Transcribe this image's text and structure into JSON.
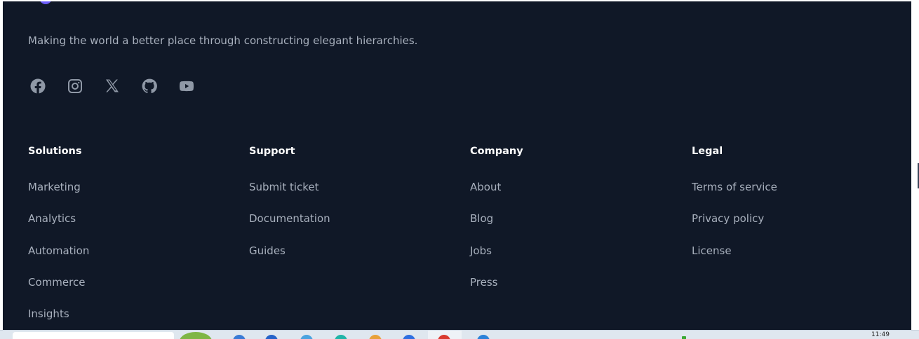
{
  "footer": {
    "tagline": "Making the world a better place through constructing elegant hierarchies.",
    "social": [
      "facebook-icon",
      "instagram-icon",
      "x-icon",
      "github-icon",
      "youtube-icon"
    ],
    "columns": [
      {
        "heading": "Solutions",
        "links": [
          "Marketing",
          "Analytics",
          "Automation",
          "Commerce",
          "Insights"
        ]
      },
      {
        "heading": "Support",
        "links": [
          "Submit ticket",
          "Documentation",
          "Guides"
        ]
      },
      {
        "heading": "Company",
        "links": [
          "About",
          "Blog",
          "Jobs",
          "Press"
        ]
      },
      {
        "heading": "Legal",
        "links": [
          "Terms of service",
          "Privacy policy",
          "License"
        ]
      }
    ]
  },
  "colors": {
    "background": "#101827",
    "heading": "#ffffff",
    "link": "#a8b0bd",
    "icon": "#8f98a6"
  },
  "taskbar": {
    "time": "11:49"
  }
}
